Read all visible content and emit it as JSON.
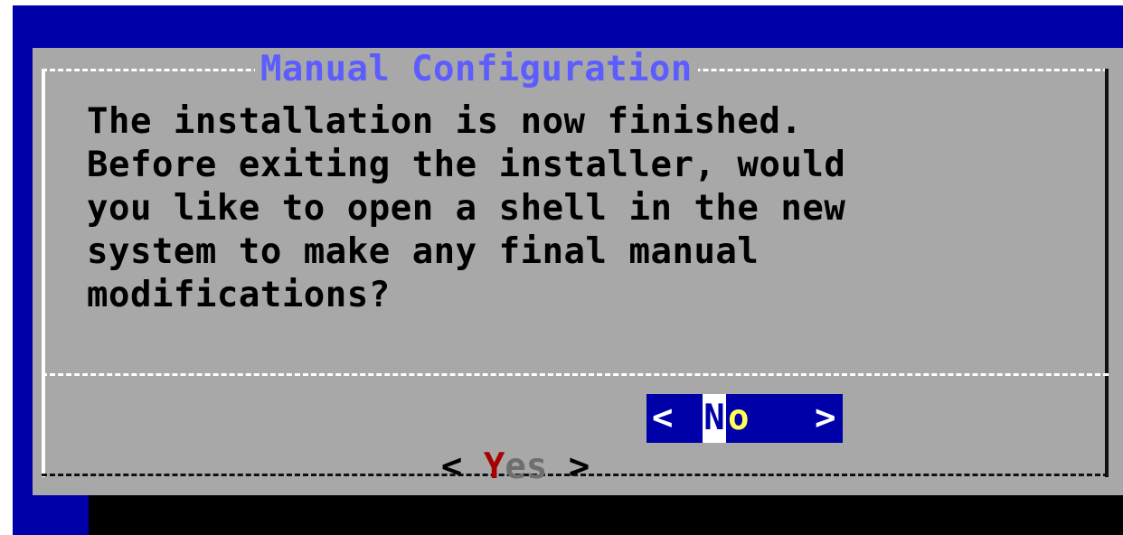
{
  "dialog": {
    "title": "Manual Configuration",
    "message_lines": [
      "The installation is now finished.",
      "Before exiting the installer, would",
      "you like to open a shell in the new",
      "system to make any final manual",
      "modifications?"
    ]
  },
  "buttons": {
    "yes": {
      "left_bracket": "<",
      "hotkey": "Y",
      "rest": "es",
      "right_bracket": ">"
    },
    "no": {
      "left_bracket": "<",
      "hotkey": "N",
      "rest": "o",
      "right_bracket": ">",
      "selected": true
    }
  },
  "colors": {
    "screen_background": "#0000a8",
    "dialog_background": "#a8a8a8",
    "title_text": "#5c5cff",
    "hotkey_inactive": "#a80000",
    "selected_button_background": "#0000a8",
    "selected_button_hotkey": "#ffff54"
  }
}
